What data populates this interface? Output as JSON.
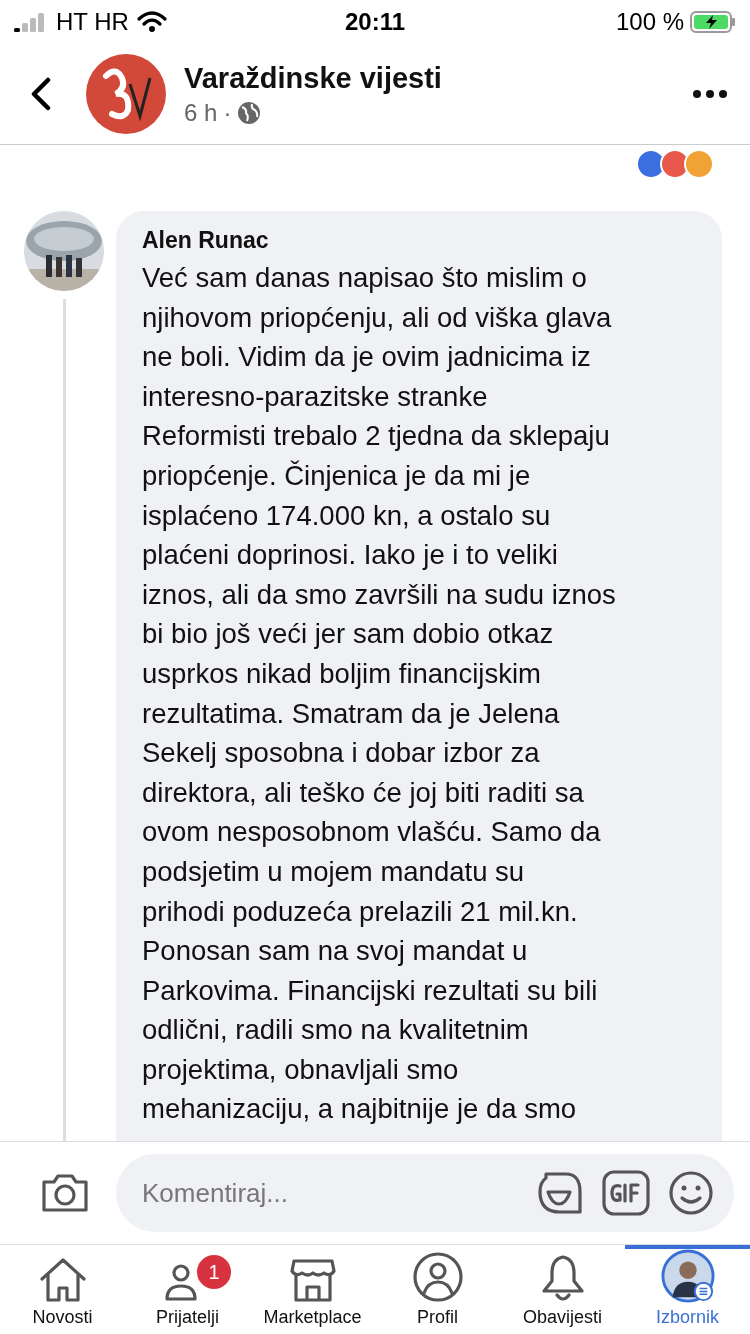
{
  "status_bar": {
    "carrier": "HT HR",
    "time": "20:11",
    "battery": "100 %"
  },
  "header": {
    "page_name": "Varaždinske vijesti",
    "time": "6 h",
    "separator": "·"
  },
  "comment": {
    "author": "Alen Runac",
    "lines": [
      "Već sam danas napisao što mislim o",
      "njihovom priopćenju, ali od viška glava",
      "ne boli. Vidim da je ovim jadnicima iz",
      "interesno-parazitske stranke",
      "Reformisti trebalo 2 tjedna da sklepaju",
      "priopćenje. Činjenica je da mi je",
      "isplaćeno 174.000 kn, a ostalo su",
      "plaćeni doprinosi. Iako je i to veliki",
      "iznos, ali da smo završili na sudu iznos",
      "bi bio još veći jer sam dobio otkaz",
      "usprkos nikad boljim financijskim",
      "rezultatima. Smatram da je Jelena",
      "Sekelj sposobna i dobar izbor za",
      "direktora, ali teško će joj biti raditi sa",
      "ovom nesposobnom vlašću. Samo da",
      "podsjetim u mojem mandatu su",
      "prihodi poduzeća prelazili 21 mil.kn.",
      "Ponosan sam na svoj mandat u",
      "Parkovima. Financijski rezultati su bili",
      "odlični, radili smo na kvalitetnim",
      "projektima, obnavljali smo",
      "mehanizaciju, a najbitnije je da smo"
    ]
  },
  "composer": {
    "placeholder": "Komentiraj..."
  },
  "nav": [
    {
      "kind": "home",
      "label": "Novosti",
      "selected": false
    },
    {
      "kind": "friends",
      "label": "Prijatelji",
      "selected": false,
      "badge": "1"
    },
    {
      "kind": "store",
      "label": "Marketplace",
      "selected": false
    },
    {
      "kind": "profile",
      "label": "Profil",
      "selected": false
    },
    {
      "kind": "bell",
      "label": "Obavijesti",
      "selected": false
    },
    {
      "kind": "avatar",
      "label": "Izbornik",
      "selected": true
    }
  ]
}
